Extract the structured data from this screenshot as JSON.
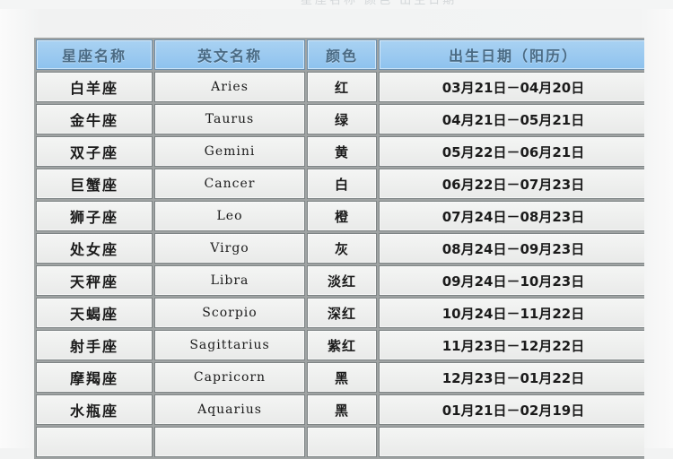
{
  "page": {
    "top_faint_text": "星座名称  颜色  出生日期",
    "background_color": "#f2f3f3"
  },
  "table": {
    "header_bg": "#9ccaf0",
    "header_text_color": "#4b6b84",
    "row_bg": "#eeefee",
    "border_color": "#7e8485",
    "columns": [
      {
        "key": "name",
        "label": "星座名称"
      },
      {
        "key": "english",
        "label": "英文名称"
      },
      {
        "key": "color",
        "label": "颜色"
      },
      {
        "key": "date",
        "label": "出生日期（阳历）"
      }
    ],
    "rows": [
      {
        "name": "白羊座",
        "english": "Aries",
        "color": "红",
        "date": "03月21日－04月20日"
      },
      {
        "name": "金牛座",
        "english": "Taurus",
        "color": "绿",
        "date": "04月21日－05月21日"
      },
      {
        "name": "双子座",
        "english": "Gemini",
        "color": "黄",
        "date": "05月22日－06月21日"
      },
      {
        "name": "巨蟹座",
        "english": "Cancer",
        "color": "白",
        "date": "06月22日－07月23日"
      },
      {
        "name": "狮子座",
        "english": "Leo",
        "color": "橙",
        "date": "07月24日－08月23日"
      },
      {
        "name": "处女座",
        "english": "Virgo",
        "color": "灰",
        "date": "08月24日－09月23日"
      },
      {
        "name": "天秤座",
        "english": "Libra",
        "color": "淡红",
        "date": "09月24日－10月23日"
      },
      {
        "name": "天蝎座",
        "english": "Scorpio",
        "color": "深红",
        "date": "10月24日－11月22日"
      },
      {
        "name": "射手座",
        "english": "Sagittarius",
        "color": "紫红",
        "date": "11月23日－12月22日"
      },
      {
        "name": "摩羯座",
        "english": "Capricorn",
        "color": "黑",
        "date": "12月23日－01月22日"
      },
      {
        "name": "水瓶座",
        "english": "Aquarius",
        "color": "黑",
        "date": "01月21日－02月19日"
      }
    ]
  }
}
